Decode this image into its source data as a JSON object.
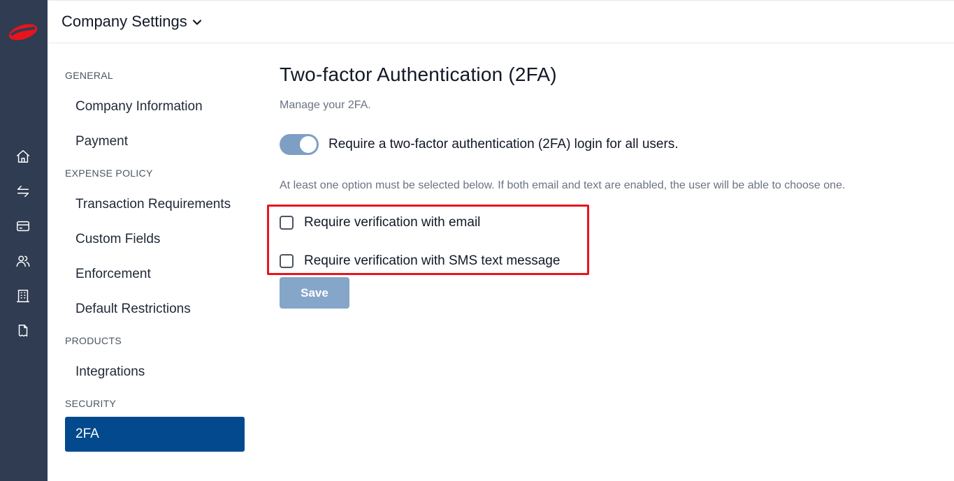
{
  "app": {
    "brand_color": "#e8141d",
    "rail_color": "#2f3c52",
    "accent_active": "#024a8d"
  },
  "rail": {
    "logo": "brand-logo-icon",
    "icons": [
      "home-icon",
      "transfer-arrows-icon",
      "card-icon",
      "users-icon",
      "building-icon",
      "receipt-icon"
    ]
  },
  "header": {
    "company_switcher": "Company Settings"
  },
  "sidebar": {
    "sections": [
      {
        "title": "GENERAL",
        "items": [
          "Company Information",
          "Payment"
        ]
      },
      {
        "title": "EXPENSE POLICY",
        "items": [
          "Transaction Requirements",
          "Custom Fields",
          "Enforcement",
          "Default Restrictions"
        ]
      },
      {
        "title": "PRODUCTS",
        "items": [
          "Integrations"
        ]
      },
      {
        "title": "SECURITY",
        "items": [
          "2FA"
        ]
      }
    ],
    "active_item": "2FA"
  },
  "main": {
    "title": "Two-factor Authentication (2FA)",
    "subtitle": "Manage your 2FA.",
    "toggle": {
      "label": "Require a two-factor authentication (2FA) login for all users.",
      "enabled": true
    },
    "hint": "At least one option must be selected below. If both email and text are enabled, the user will be able to choose one.",
    "options": [
      {
        "label": "Require verification with email",
        "checked": false
      },
      {
        "label": "Require verification with SMS text message",
        "checked": false
      }
    ],
    "save_label": "Save"
  }
}
